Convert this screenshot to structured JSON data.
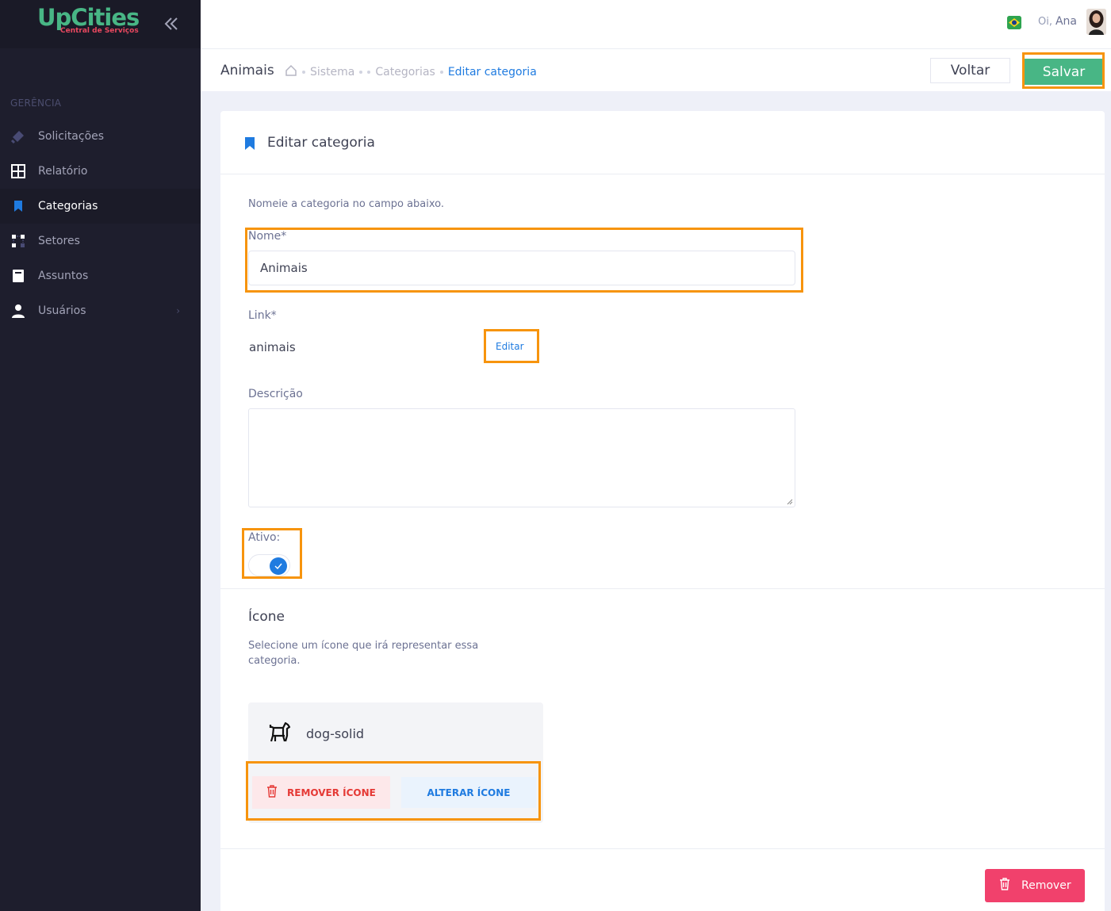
{
  "brand": {
    "name": "UpCities",
    "tagline": "Central de Serviços"
  },
  "sidebar": {
    "section_label": "GERÊNCIA",
    "items": [
      {
        "label": "Solicitações",
        "icon": "ticket-icon"
      },
      {
        "label": "Relatório",
        "icon": "grid-icon"
      },
      {
        "label": "Categorias",
        "icon": "bookmark-icon",
        "active": true
      },
      {
        "label": "Setores",
        "icon": "nodes-icon"
      },
      {
        "label": "Assuntos",
        "icon": "book-icon"
      },
      {
        "label": "Usuários",
        "icon": "user-icon",
        "has_submenu": true
      }
    ]
  },
  "topbar": {
    "greeting": "Oi,",
    "user_name": "Ana",
    "language_flag": "brazil-flag-icon"
  },
  "subheader": {
    "title": "Animais",
    "breadcrumbs": [
      "Sistema",
      "Categorias",
      "Editar categoria"
    ],
    "back_label": "Voltar",
    "save_label": "Salvar"
  },
  "form": {
    "card_title": "Editar categoria",
    "hint": "Nomeie a categoria no campo abaixo.",
    "name_label": "Nome*",
    "name_value": "Animais",
    "link_label": "Link*",
    "link_value": "animais",
    "link_edit_label": "Editar",
    "description_label": "Descrição",
    "description_value": "",
    "active_label": "Ativo:",
    "active": true
  },
  "icon_section": {
    "title": "Ícone",
    "hint": "Selecione um ícone que irá representar essa categoria.",
    "icon_name": "dog-solid",
    "remove_icon_label": "REMOVER ÍCONE",
    "change_icon_label": "ALTERAR ÍCONE"
  },
  "footer": {
    "remove_label": "Remover"
  },
  "colors": {
    "accent": "#1f7be0",
    "success": "#48b685",
    "danger": "#f1416c",
    "highlight": "#f7940d",
    "sidebar": "#1e1e2d"
  }
}
